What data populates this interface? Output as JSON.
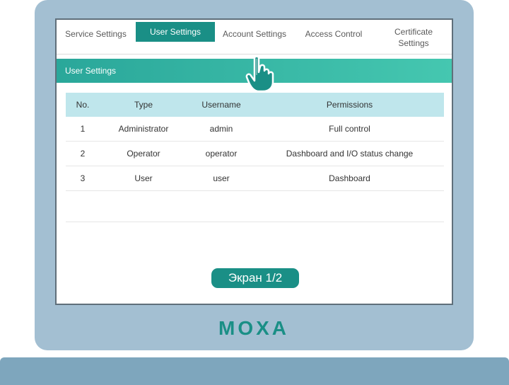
{
  "tabs": [
    {
      "label": "Service Settings",
      "active": false
    },
    {
      "label": "User Settings",
      "active": true
    },
    {
      "label": "Account Settings",
      "active": false
    },
    {
      "label": "Access Control",
      "active": false
    },
    {
      "label": "Certificate Settings",
      "active": false
    }
  ],
  "section": {
    "title": "User Settings"
  },
  "table": {
    "headers": {
      "no": "No.",
      "type": "Type",
      "username": "Username",
      "permissions": "Permissions"
    },
    "rows": [
      {
        "no": "1",
        "type": "Administrator",
        "username": "admin",
        "permissions": "Full control"
      },
      {
        "no": "2",
        "type": "Operator",
        "username": "operator",
        "permissions": "Dashboard and I/O status change"
      },
      {
        "no": "3",
        "type": "User",
        "username": "user",
        "permissions": "Dashboard"
      }
    ]
  },
  "pager": {
    "label": "Экран 1/2"
  },
  "brand": {
    "logo_text": "MOXA"
  },
  "colors": {
    "accent": "#1a8f86",
    "header_gradient_start": "#2aa79a",
    "header_gradient_end": "#45c7b0",
    "table_head": "#bfe6ec",
    "bezel": "#a3bfd2",
    "logo": "#1a8f86"
  },
  "icons": {
    "pointer": "pointing-hand-icon"
  }
}
